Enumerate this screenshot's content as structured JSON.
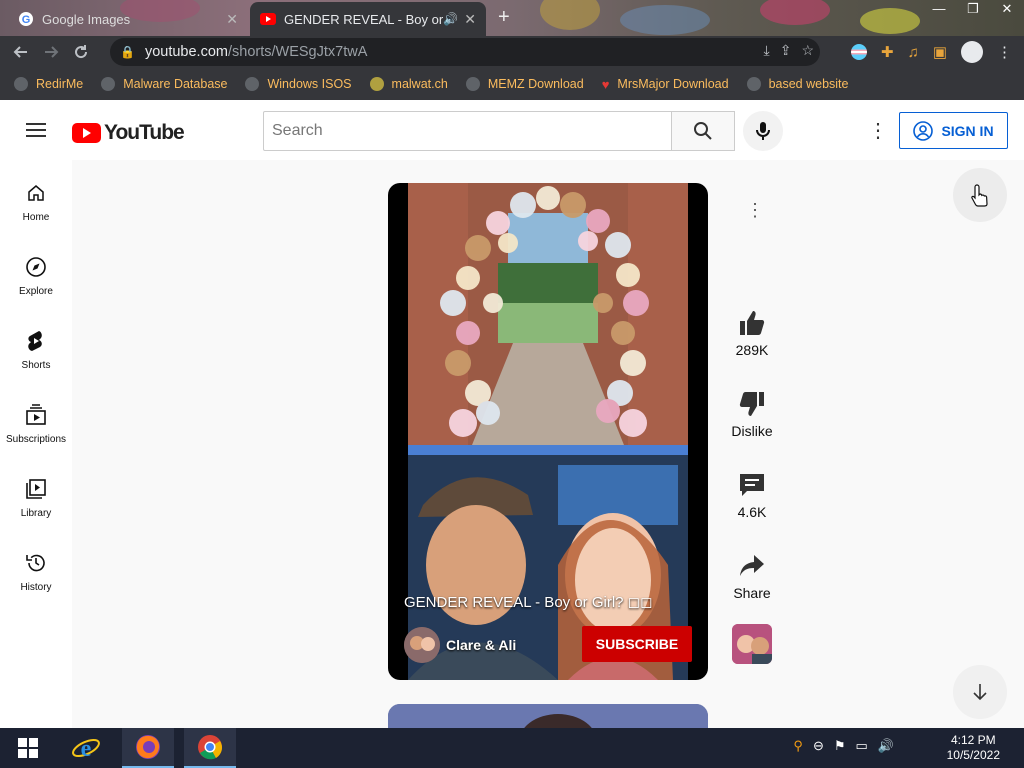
{
  "browser": {
    "tabs": [
      {
        "title": "Google Images",
        "active": false
      },
      {
        "title": "GENDER REVEAL - Boy or Gi",
        "active": true
      }
    ],
    "new_tab": "+",
    "address": {
      "host": "youtube.com",
      "path": "/shorts/WESgJtx7twA"
    },
    "bookmarks": [
      "RedirMe",
      "Malware Database",
      "Windows ISOS",
      "malwat.ch",
      "MEMZ Download",
      "MrsMajor Download",
      "based website"
    ],
    "colors": {
      "toolbar": "#35363a",
      "bookmark_text": "#fbbc5e"
    }
  },
  "youtube": {
    "logo_text": "YouTube",
    "search_placeholder": "Search",
    "sign_in": "SIGN IN",
    "sidebar": [
      {
        "label": "Home",
        "icon": "home-icon"
      },
      {
        "label": "Explore",
        "icon": "compass-icon"
      },
      {
        "label": "Shorts",
        "icon": "shorts-icon"
      },
      {
        "label": "Subscriptions",
        "icon": "subscriptions-icon"
      },
      {
        "label": "Library",
        "icon": "library-icon"
      },
      {
        "label": "History",
        "icon": "history-icon"
      }
    ],
    "short": {
      "title": "GENDER REVEAL - Boy or Girl? ◻◻",
      "channel": "Clare & Ali",
      "subscribe": "SUBSCRIBE",
      "likes": "289K",
      "dislike": "Dislike",
      "comments": "4.6K",
      "share": "Share"
    },
    "colors": {
      "brand": "#ff0000",
      "subscribe": "#cc0000",
      "signin": "#065fd4"
    }
  },
  "taskbar": {
    "time": "4:12 PM",
    "date": "10/5/2022"
  }
}
